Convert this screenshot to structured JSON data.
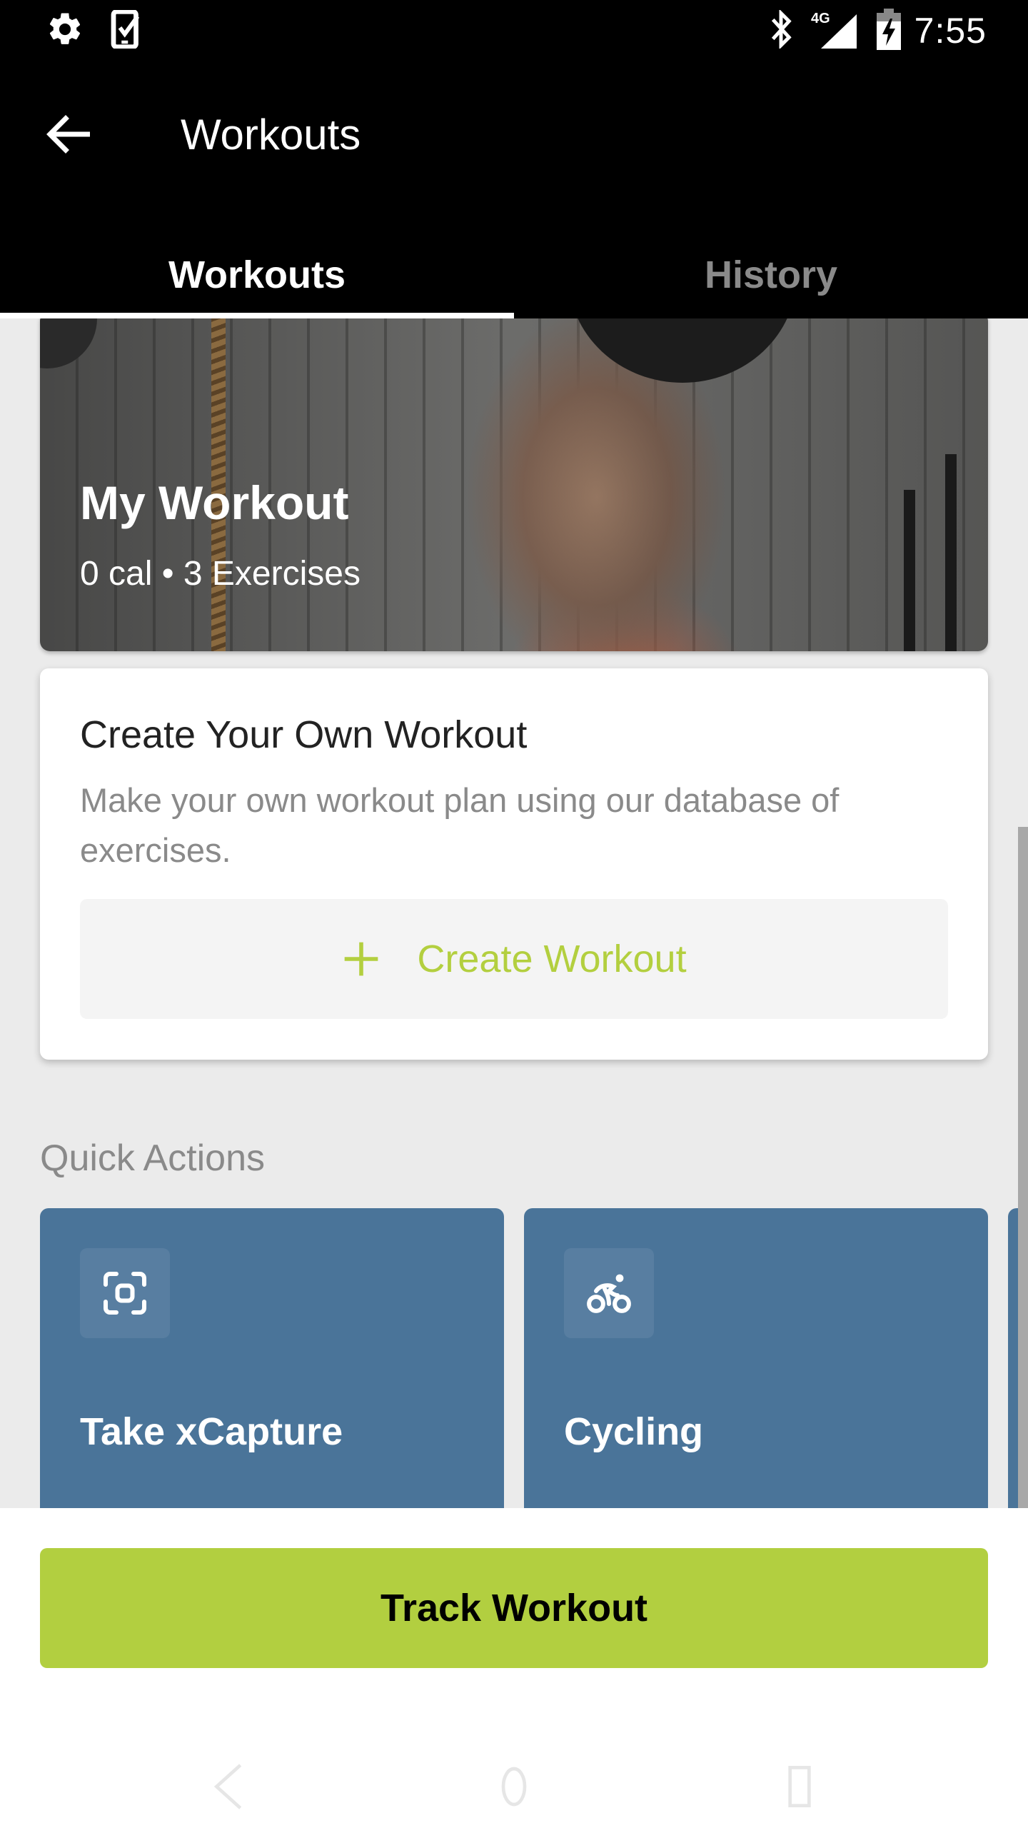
{
  "status_bar": {
    "left_icons": [
      "settings-icon",
      "task-check-icon"
    ],
    "right_icons": [
      "bluetooth-icon",
      "signal-4g-icon",
      "battery-charging-icon"
    ],
    "network_label": "4G",
    "time": "7:55"
  },
  "app_bar": {
    "back_icon": "arrow-left-icon",
    "title": "Workouts"
  },
  "tabs": [
    {
      "label": "Workouts",
      "active": true
    },
    {
      "label": "History",
      "active": false
    }
  ],
  "hero_card": {
    "title": "My Workout",
    "subtitle": "0 cal • 3 Exercises"
  },
  "create_card": {
    "title": "Create Your Own Workout",
    "description": "Make your own workout plan using our database of exercises.",
    "button_icon": "plus-icon",
    "button_label": "Create Workout"
  },
  "quick_actions": {
    "title": "Quick Actions",
    "items": [
      {
        "label": "Take xCapture",
        "icon": "capture-frame-icon"
      },
      {
        "label": "Cycling",
        "icon": "cycling-icon"
      }
    ]
  },
  "bottom": {
    "primary_button": "Track Workout"
  },
  "nav_bar": {
    "items": [
      "back-nav-icon",
      "home-nav-icon",
      "recents-nav-icon"
    ]
  },
  "colors": {
    "accent_green": "#b2cf40",
    "quick_action_blue": "#4a7499",
    "app_bar_bg": "#000000",
    "page_bg": "#ebebeb"
  }
}
